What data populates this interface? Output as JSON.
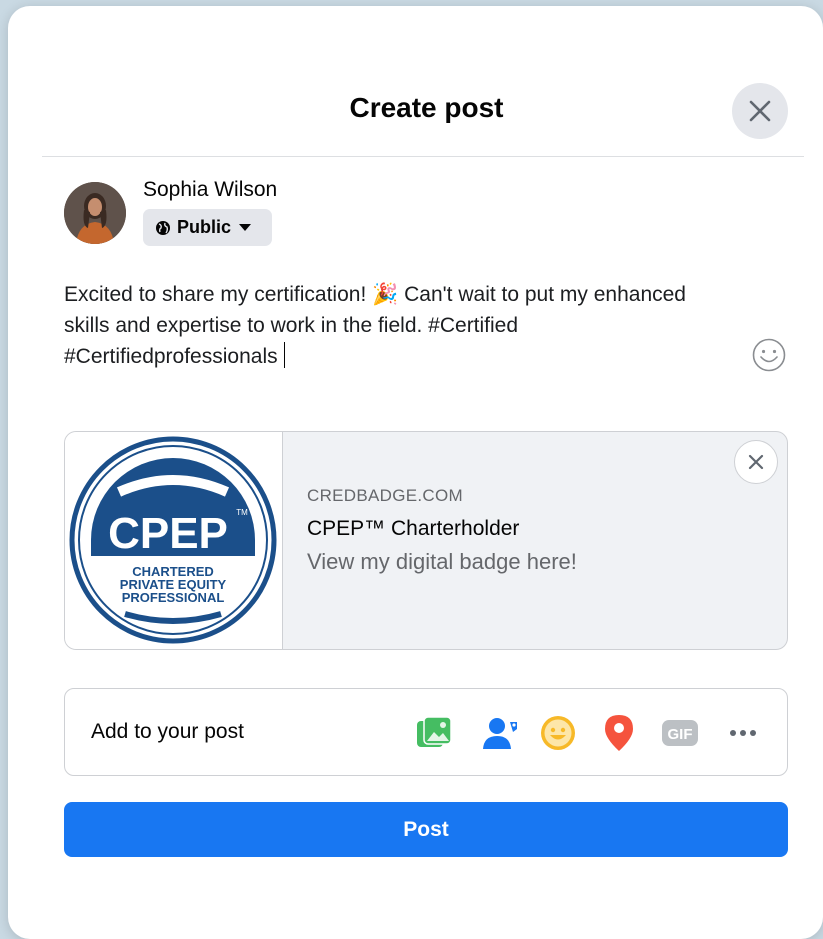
{
  "dialog": {
    "title": "Create post",
    "close_icon": "close-icon"
  },
  "author": {
    "name": "Sophia Wilson",
    "avatar_icon": "avatar",
    "audience": {
      "label": "Public",
      "icon": "globe-icon",
      "dropdown_icon": "caret-down-icon"
    }
  },
  "composer": {
    "text_before_emoji": "Excited to share my certification!",
    "emoji": "🎉",
    "text_after_emoji": "Can't wait to put my enhanced",
    "line2": "skills and expertise to work in the field. #Certified",
    "line3": "#Certifiedprofessionals",
    "emoji_picker_icon": "smiley-icon"
  },
  "link_preview": {
    "domain": "CREDBADGE.COM",
    "title": "CPEP™ Charterholder",
    "description": "View my digital badge here!",
    "badge": {
      "acronym": "CPEP",
      "tm": "TM",
      "line1": "CHARTERED",
      "line2": "PRIVATE EQUITY",
      "line3": "PROFESSIONAL"
    }
  },
  "add_to_post": {
    "label": "Add to your post",
    "items": [
      {
        "name": "photo-video-icon",
        "color": "#45bd62"
      },
      {
        "name": "tag-people-icon",
        "color": "#1877f2"
      },
      {
        "name": "feeling-activity-icon",
        "color": "#f7b928"
      },
      {
        "name": "check-in-icon",
        "color": "#f5533d"
      },
      {
        "name": "gif-icon",
        "label": "GIF",
        "color": "#bcc0c4"
      },
      {
        "name": "more-icon",
        "color": "#606770"
      }
    ]
  },
  "post_button": {
    "label": "Post"
  },
  "colors": {
    "accent": "#1877f2",
    "badge_blue": "#1b4f8a"
  }
}
